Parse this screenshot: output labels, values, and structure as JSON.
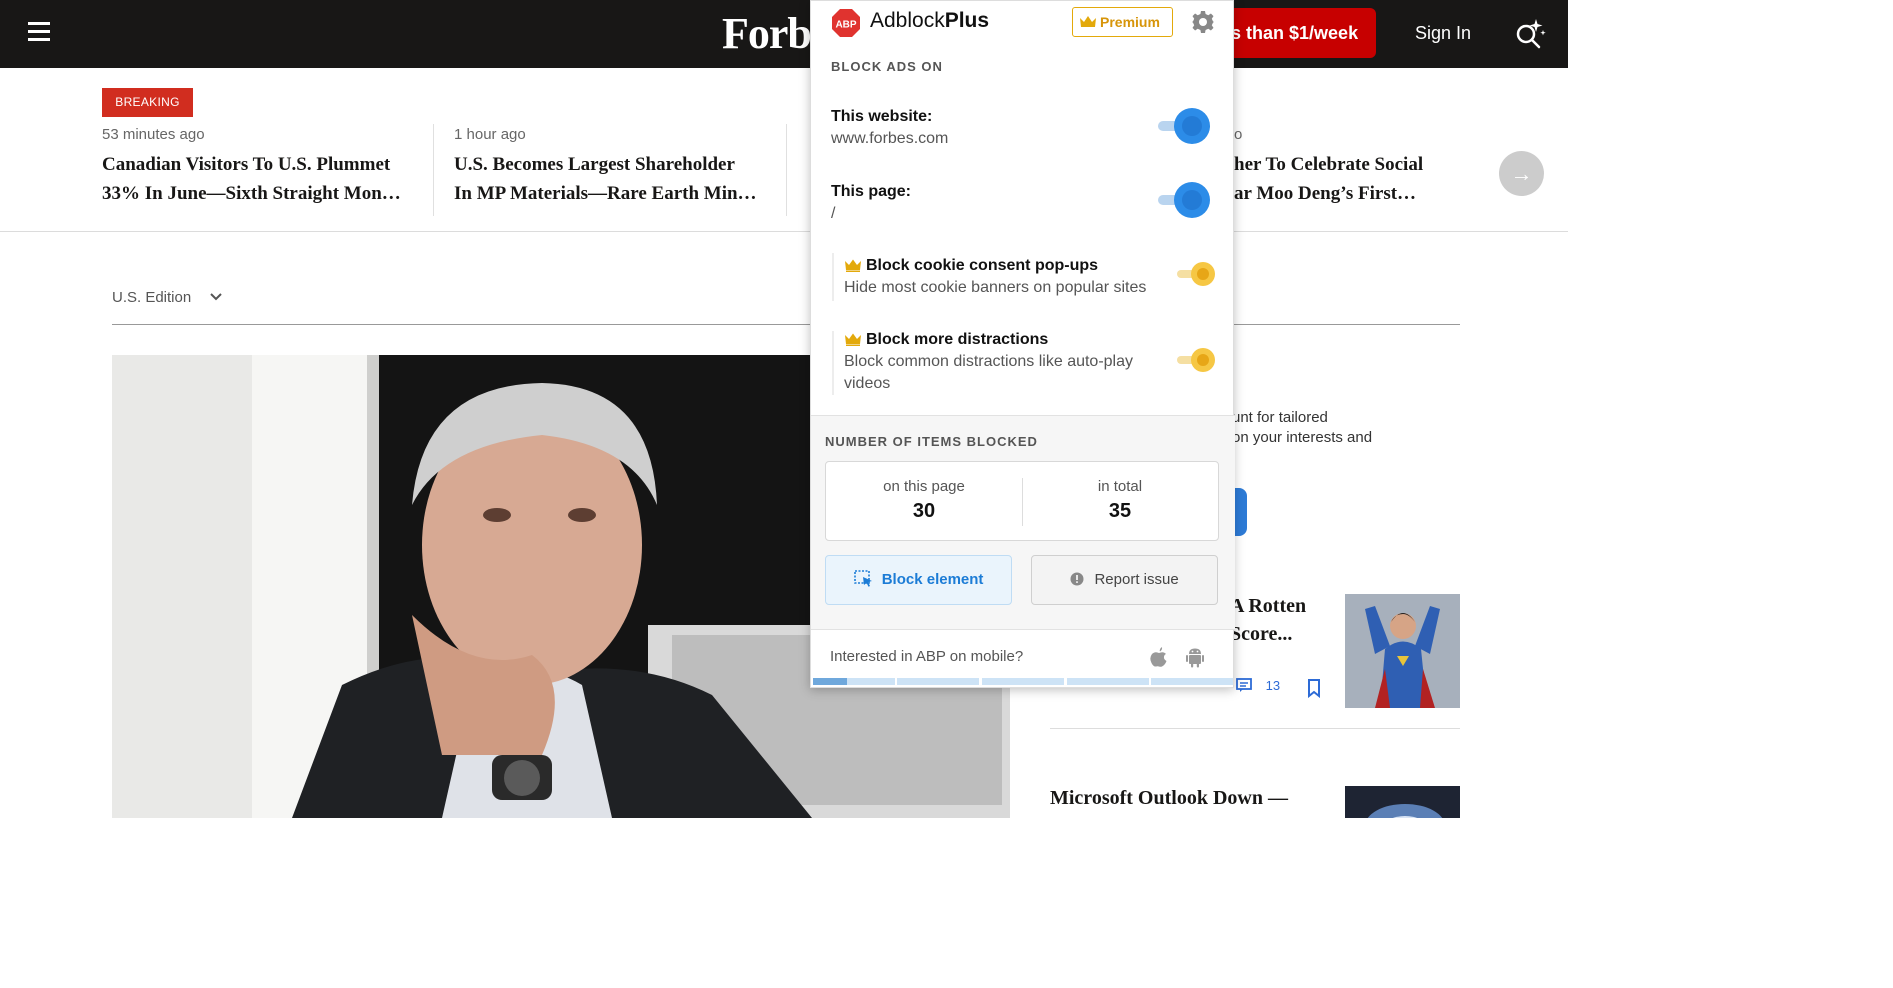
{
  "header": {
    "logo_text": "Forbes",
    "subscribe_label": "Less than $1/week",
    "signin_label": "Sign In"
  },
  "breaking": {
    "badge": "BREAKING",
    "items": [
      {
        "time": "53 minutes ago",
        "line1": "Canadian Visitors To U.S. Plummet",
        "line2": "33% In June—Sixth Straight Mon…"
      },
      {
        "time": "1 hour ago",
        "line1": "U.S. Becomes Largest Shareholder",
        "line2": "In MP Materials—Rare Earth Min…"
      },
      {
        "time": "o",
        "line1": "her To Celebrate Social",
        "line2": "ar Moo Deng’s First…"
      }
    ],
    "next_arrow": "→"
  },
  "edition": {
    "label": "U.S. Edition"
  },
  "right_column": {
    "promo_line1": "unt for tailored",
    "promo_line2": "on your interests and",
    "story1_line1": "A Rotten",
    "story1_line2": "Score...",
    "story1_comments": "13",
    "story2_line1": "Microsoft Outlook Down —"
  },
  "abp": {
    "brand_light": "Adblock",
    "brand_bold": "Plus",
    "logo_text": "ABP",
    "premium_label": "Premium",
    "block_ads_title": "BLOCK ADS ON",
    "website_label": "This website:",
    "website_value": "www.forbes.com",
    "page_label": "This page:",
    "page_value": "/",
    "cookie_label": "Block cookie consent pop-ups",
    "cookie_sub": "Hide most cookie banners on popular sites",
    "distractions_label": "Block more distractions",
    "distractions_sub_1": "Block common distractions like auto-play",
    "distractions_sub_2": "videos",
    "stats_title": "NUMBER OF ITEMS BLOCKED",
    "on_page_label": "on this page",
    "on_page_value": "30",
    "total_label": "in total",
    "total_value": "35",
    "block_element_label": "Block element",
    "report_issue_label": "Report issue",
    "mobile_text": "Interested in ABP on mobile?"
  },
  "colors": {
    "abp_blue": "#2c8ce8",
    "premium_gold": "#f6c744",
    "forbes_red": "#c70000",
    "breaking_red": "#d12d1f"
  }
}
